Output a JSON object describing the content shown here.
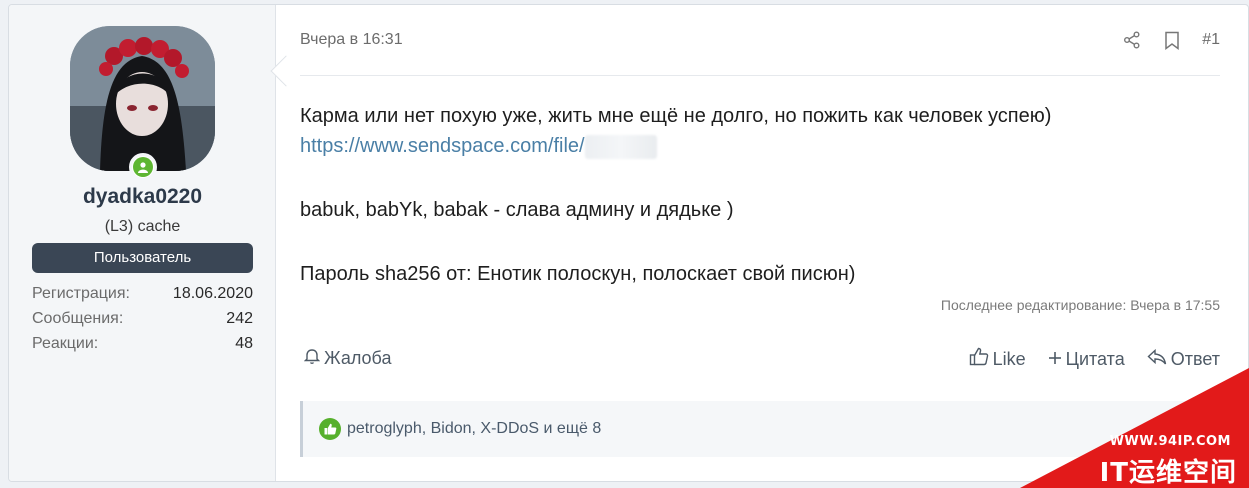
{
  "user": {
    "username": "dyadka0220",
    "title": "(L3) cache",
    "role": "Пользователь",
    "stats": [
      {
        "label": "Регистрация:",
        "value": "18.06.2020"
      },
      {
        "label": "Сообщения:",
        "value": "242"
      },
      {
        "label": "Реакции:",
        "value": "48"
      }
    ]
  },
  "message": {
    "date": "Вчера в 16:31",
    "post_number": "#1",
    "lines": [
      "Карма или нет похую уже, жить мне ещё не долго, но пожить как человек успею)",
      "https://www.sendspace.com/file/",
      "babuk, babYk, babak - слава админу и дядьке )",
      "Пароль sha256 от: Енотик полоскун, полоскает свой писюн)"
    ],
    "edited": "Последнее редактирование: Вчера в 17:55"
  },
  "actions": {
    "report": "Жалоба",
    "like": "Like",
    "quote": "Цитата",
    "reply": "Ответ"
  },
  "reactions": {
    "text": "petroglyph, Bidon, X-DDoS и ещё 8"
  },
  "watermark": {
    "url": "WWW.94IP.COM",
    "name": "IT运维空间"
  },
  "colors": {
    "online": "#5eb632",
    "badge_bg": "#3a4655",
    "link": "#4a7fa6",
    "like": "#56b02c",
    "watermark": "#e21a1a"
  },
  "icons": [
    "share-icon",
    "bookmark-icon",
    "bell-icon",
    "thumbs-up-icon",
    "plus-icon",
    "reply-icon",
    "like-reaction-icon",
    "online-status-icon"
  ]
}
